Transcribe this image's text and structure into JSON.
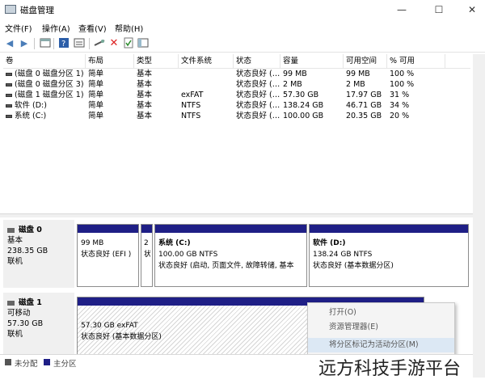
{
  "window": {
    "title": "磁盘管理",
    "min_label": "—",
    "max_label": "☐",
    "close_label": "✕"
  },
  "menu": [
    "文件(F)",
    "操作(A)",
    "查看(V)",
    "帮助(H)"
  ],
  "toolbar_icons": [
    "back-arrow-icon",
    "forward-arrow-icon",
    "console-tree-icon",
    "help-icon",
    "properties-icon",
    "connect-icon",
    "delete-icon",
    "check-icon",
    "new-window-icon"
  ],
  "columns": [
    "卷",
    "布局",
    "类型",
    "文件系统",
    "状态",
    "容量",
    "可用空间",
    "% 可用"
  ],
  "volumes": [
    {
      "name": "(磁盘 0 磁盘分区 1)",
      "layout": "简单",
      "type": "基本",
      "fs": "",
      "status": "状态良好 (…",
      "capacity": "99 MB",
      "free": "99 MB",
      "pct": "100 %"
    },
    {
      "name": "(磁盘 0 磁盘分区 3)",
      "layout": "简单",
      "type": "基本",
      "fs": "",
      "status": "状态良好 (…",
      "capacity": "2 MB",
      "free": "2 MB",
      "pct": "100 %"
    },
    {
      "name": "(磁盘 1 磁盘分区 1)",
      "layout": "简单",
      "type": "基本",
      "fs": "exFAT",
      "status": "状态良好 (…",
      "capacity": "57.30 GB",
      "free": "17.97 GB",
      "pct": "31 %"
    },
    {
      "name": "软件 (D:)",
      "layout": "简单",
      "type": "基本",
      "fs": "NTFS",
      "status": "状态良好 (…",
      "capacity": "138.24 GB",
      "free": "46.71 GB",
      "pct": "34 %"
    },
    {
      "name": "系统 (C:)",
      "layout": "简单",
      "type": "基本",
      "fs": "NTFS",
      "status": "状态良好 (…",
      "capacity": "100.00 GB",
      "free": "20.35 GB",
      "pct": "20 %"
    }
  ],
  "disk0": {
    "name": "磁盘 0",
    "kind": "基本",
    "size": "238.35 GB",
    "state": "联机",
    "partitions": [
      {
        "title": "",
        "line1": "99 MB",
        "line2": "状态良好 (EFI )"
      },
      {
        "title": "",
        "line1": "2",
        "line2": "状"
      },
      {
        "title": "系统  (C:)",
        "line1": "100.00 GB NTFS",
        "line2": "状态良好 (启动, 页面文件, 故障转储, 基本"
      },
      {
        "title": "软件  (D:)",
        "line1": "138.24 GB NTFS",
        "line2": "状态良好 (基本数据分区)"
      }
    ]
  },
  "disk1": {
    "name": "磁盘 1",
    "kind": "可移动",
    "size": "57.30 GB",
    "state": "联机",
    "partition": {
      "line1": "57.30 GB exFAT",
      "line2": "状态良好 (基本数据分区)"
    }
  },
  "context_menu": [
    "打开(O)",
    "资源管理器(E)",
    "将分区标记为活动分区(M)"
  ],
  "legend": [
    {
      "label": "未分配",
      "color": "#555555"
    },
    {
      "label": "主分区",
      "color": "#1f1f86"
    }
  ],
  "watermark": "远方科技手游平台"
}
